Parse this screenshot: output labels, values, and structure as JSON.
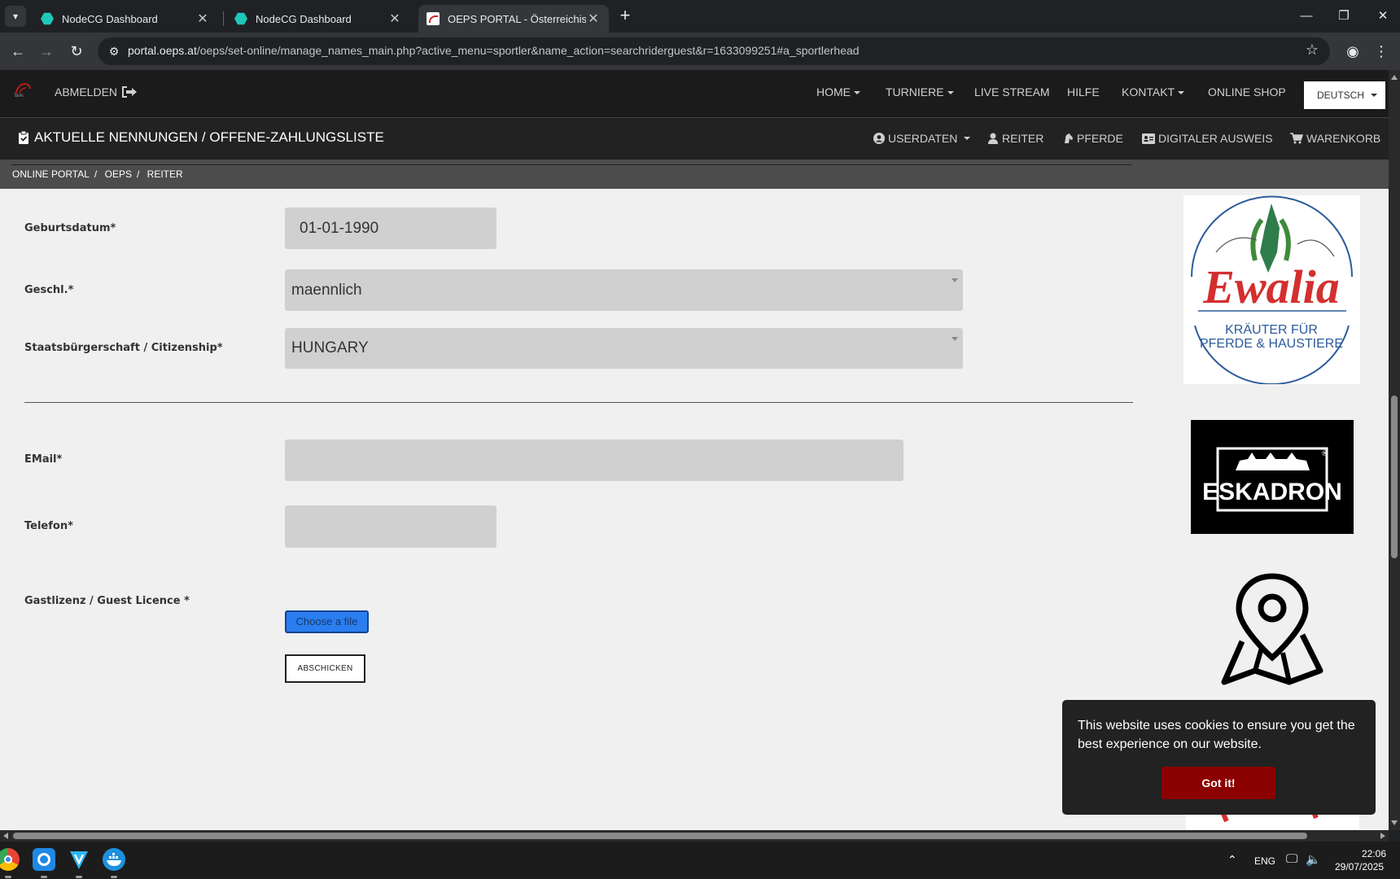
{
  "browser": {
    "tabs": [
      {
        "title": "NodeCG Dashboard",
        "favicon": "nodecg-icon",
        "active": false
      },
      {
        "title": "NodeCG Dashboard",
        "favicon": "nodecg-icon",
        "active": false
      },
      {
        "title": "OEPS PORTAL - Österreichische",
        "favicon": "oeps-icon",
        "active": true
      }
    ],
    "url_host": "portal.oeps.at",
    "url_path": "/oeps/set-online/manage_names_main.php?active_menu=sportler&name_action=searchriderguest&r=1633099251#a_sportlerhead"
  },
  "topnav": {
    "abmelden": "ABMELDEN",
    "items": [
      "HOME",
      "TURNIERE",
      "LIVE STREAM",
      "HILFE",
      "KONTAKT",
      "ONLINE SHOP"
    ],
    "language": "DEUTSCH"
  },
  "subnav": {
    "heading": "AKTUELLE NENNUNGEN / OFFENE-ZAHLUNGSLISTE",
    "items": [
      "USERDATEN",
      "REITER",
      "PFERDE",
      "DIGITALER AUSWEIS",
      "WARENKORB"
    ]
  },
  "breadcrumb": [
    "ONLINE PORTAL",
    "OEPS",
    "REITER"
  ],
  "form": {
    "birth_label": "Geburtsdatum*",
    "birth_value": "01-01-1990",
    "gender_label": "Geschl.*",
    "gender_value": "maennlich",
    "citizenship_label": "Staatsbürgerschaft / Citizenship*",
    "citizenship_value": "HUNGARY",
    "email_label": "EMail*",
    "email_value": "",
    "phone_label": "Telefon*",
    "phone_value": "",
    "licence_label": "Gastlizenz / Guest Licence *",
    "file_button": "Choose a file",
    "submit_button": "ABSCHICKEN"
  },
  "ads": {
    "ewalia_name": "Ewalia",
    "ewalia_line1": "KRÄUTER FÜR",
    "ewalia_line2": "PFERDE & HAUSTIERE",
    "eskadron_name": "ESKADRON"
  },
  "cookie": {
    "message": "This website uses cookies to ensure you get the best experience on our website.",
    "button": "Got it!"
  },
  "taskbar": {
    "lang": "ENG",
    "time": "22:06",
    "date": "29/07/2025"
  },
  "colors": {
    "accent_blue": "#2b7ef0",
    "cookie_button": "#8b0000",
    "ewalia_red": "#d32f2f",
    "ewalia_blue": "#2c5b9a",
    "ewalia_green": "#3e8b3a"
  }
}
